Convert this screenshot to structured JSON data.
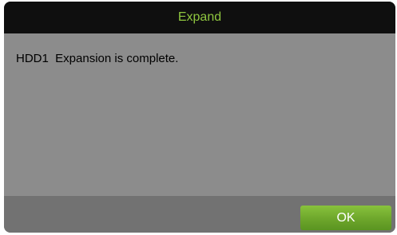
{
  "dialog": {
    "title": "Expand",
    "message": "HDD1  Expansion is complete.",
    "ok_label": "OK"
  },
  "colors": {
    "title_text": "#8fc63f",
    "titlebar_bg": "#0f0f0f",
    "body_bg": "#8c8c8c",
    "footer_bg": "#727272",
    "button_green": "#6ba42a"
  }
}
